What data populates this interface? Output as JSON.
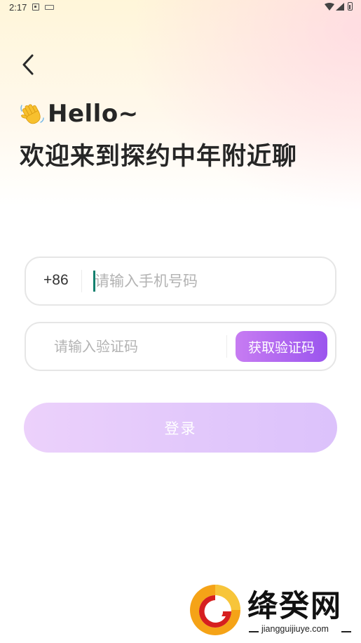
{
  "status_bar": {
    "time": "2:17"
  },
  "nav": {
    "back_icon": "chevron-left-icon"
  },
  "header": {
    "wave_icon": "waving-hand-emoji",
    "hello": "Hello~",
    "welcome": "欢迎来到探约中年附近聊"
  },
  "phone_field": {
    "country_code": "+86",
    "placeholder": "请输入手机号码",
    "value": ""
  },
  "code_field": {
    "placeholder": "请输入验证码",
    "value": "",
    "get_code_label": "获取验证码"
  },
  "login": {
    "label": "登录"
  },
  "watermark": {
    "title": "绛癸网",
    "url": "jiangguijiuye.com"
  },
  "colors": {
    "accent": "#9b55ee",
    "accent_light": "#c77cf2",
    "login_disabled": "#e6cbfb",
    "cursor": "#12806e"
  }
}
